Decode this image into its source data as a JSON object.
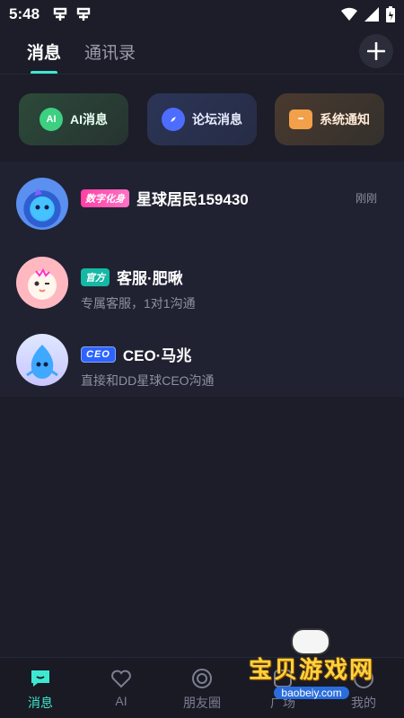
{
  "status_bar": {
    "time": "5:48"
  },
  "tabs": {
    "messages": "消息",
    "contacts": "通讯录"
  },
  "quick_actions": [
    {
      "label": "AI消息",
      "icon_text": "AI"
    },
    {
      "label": "论坛消息"
    },
    {
      "label": "系统通知"
    }
  ],
  "conversations": [
    {
      "badge": "数字化身",
      "name": "星球居民159430",
      "subtitle": "",
      "time": "刚刚"
    },
    {
      "badge": "官方",
      "name": "客服·肥啾",
      "subtitle": "专属客服，1对1沟通",
      "time": ""
    },
    {
      "badge": "CEO",
      "name": "CEO·马兆",
      "subtitle": "直接和DD星球CEO沟通",
      "time": ""
    }
  ],
  "bottom_nav": [
    {
      "label": "消息",
      "icon": "chat-bubble-icon",
      "active": true
    },
    {
      "label": "AI",
      "icon": "heart-icon"
    },
    {
      "label": "朋友圈",
      "icon": "circle-icon"
    },
    {
      "label": "广场",
      "icon": "square-icon"
    },
    {
      "label": "我的",
      "icon": "profile-icon"
    }
  ],
  "watermark": {
    "text": "宝贝游戏网",
    "url": "baobeiy.com"
  },
  "colors": {
    "accent": "#3ee8d0",
    "background": "#1c1d29"
  }
}
